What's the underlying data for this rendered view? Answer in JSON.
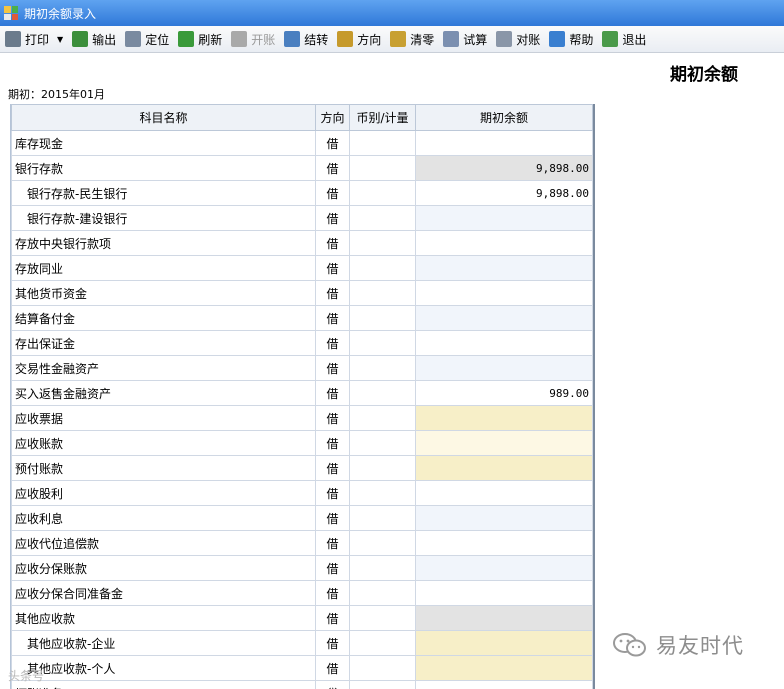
{
  "window": {
    "title": "期初余额录入"
  },
  "toolbar": {
    "items": [
      {
        "label": "打印",
        "icon": "printer-icon",
        "color": "#6b7b8c"
      },
      {
        "label": "输出",
        "icon": "export-icon",
        "color": "#3c8f3c"
      },
      {
        "label": "定位",
        "icon": "locate-icon",
        "color": "#7a8aa0"
      },
      {
        "label": "刷新",
        "icon": "refresh-icon",
        "color": "#3a9a3a"
      },
      {
        "label": "开账",
        "icon": "open-ledger-icon",
        "color": "#a9a9a9",
        "disabled": true
      },
      {
        "label": "结转",
        "icon": "carry-forward-icon",
        "color": "#4a7fc0"
      },
      {
        "label": "方向",
        "icon": "direction-icon",
        "color": "#c69a2c"
      },
      {
        "label": "清零",
        "icon": "broom-icon",
        "color": "#c8a032"
      },
      {
        "label": "试算",
        "icon": "trial-balance-icon",
        "color": "#7b8fb0"
      },
      {
        "label": "对账",
        "icon": "reconcile-icon",
        "color": "#8a96a8"
      },
      {
        "label": "帮助",
        "icon": "help-icon",
        "color": "#3a7fd0"
      },
      {
        "label": "退出",
        "icon": "exit-icon",
        "color": "#4a9a4a"
      }
    ]
  },
  "header": {
    "page_title": "期初余额",
    "period": "期初：2015年01月"
  },
  "table": {
    "columns": [
      "科目名称",
      "方向",
      "币别/计量",
      "期初余额"
    ],
    "rows": [
      {
        "name": "库存现金",
        "direction": "借",
        "currency": "",
        "amount": "",
        "sub": false,
        "cell": "white"
      },
      {
        "name": "银行存款",
        "direction": "借",
        "currency": "",
        "amount": "9,898.00",
        "sub": false,
        "cell": "gray"
      },
      {
        "name": "银行存款-民生银行",
        "direction": "借",
        "currency": "",
        "amount": "9,898.00",
        "sub": true,
        "cell": "white"
      },
      {
        "name": "银行存款-建设银行",
        "direction": "借",
        "currency": "",
        "amount": "",
        "sub": true,
        "cell": "blue"
      },
      {
        "name": "存放中央银行款项",
        "direction": "借",
        "currency": "",
        "amount": "",
        "sub": false,
        "cell": "white"
      },
      {
        "name": "存放同业",
        "direction": "借",
        "currency": "",
        "amount": "",
        "sub": false,
        "cell": "blue"
      },
      {
        "name": "其他货币资金",
        "direction": "借",
        "currency": "",
        "amount": "",
        "sub": false,
        "cell": "white"
      },
      {
        "name": "结算备付金",
        "direction": "借",
        "currency": "",
        "amount": "",
        "sub": false,
        "cell": "blue"
      },
      {
        "name": "存出保证金",
        "direction": "借",
        "currency": "",
        "amount": "",
        "sub": false,
        "cell": "white"
      },
      {
        "name": "交易性金融资产",
        "direction": "借",
        "currency": "",
        "amount": "",
        "sub": false,
        "cell": "blue"
      },
      {
        "name": "买入返售金融资产",
        "direction": "借",
        "currency": "",
        "amount": "989.00",
        "sub": false,
        "cell": "white"
      },
      {
        "name": "应收票据",
        "direction": "借",
        "currency": "",
        "amount": "",
        "sub": false,
        "cell": "yellow"
      },
      {
        "name": "应收账款",
        "direction": "借",
        "currency": "",
        "amount": "",
        "sub": false,
        "cell": "cream"
      },
      {
        "name": "预付账款",
        "direction": "借",
        "currency": "",
        "amount": "",
        "sub": false,
        "cell": "yellow"
      },
      {
        "name": "应收股利",
        "direction": "借",
        "currency": "",
        "amount": "",
        "sub": false,
        "cell": "white"
      },
      {
        "name": "应收利息",
        "direction": "借",
        "currency": "",
        "amount": "",
        "sub": false,
        "cell": "blue"
      },
      {
        "name": "应收代位追偿款",
        "direction": "借",
        "currency": "",
        "amount": "",
        "sub": false,
        "cell": "white"
      },
      {
        "name": "应收分保账款",
        "direction": "借",
        "currency": "",
        "amount": "",
        "sub": false,
        "cell": "blue"
      },
      {
        "name": "应收分保合同准备金",
        "direction": "借",
        "currency": "",
        "amount": "",
        "sub": false,
        "cell": "white"
      },
      {
        "name": "其他应收款",
        "direction": "借",
        "currency": "",
        "amount": "",
        "sub": false,
        "cell": "gray"
      },
      {
        "name": "其他应收款-企业",
        "direction": "借",
        "currency": "",
        "amount": "",
        "sub": true,
        "cell": "yellow"
      },
      {
        "name": "其他应收款-个人",
        "direction": "借",
        "currency": "",
        "amount": "",
        "sub": true,
        "cell": "yellow"
      },
      {
        "name": "坏账准备",
        "direction": "贷",
        "currency": "",
        "amount": "",
        "sub": false,
        "cell": "white"
      }
    ]
  },
  "watermark": {
    "text": "易友时代",
    "small_text": "头条号"
  }
}
